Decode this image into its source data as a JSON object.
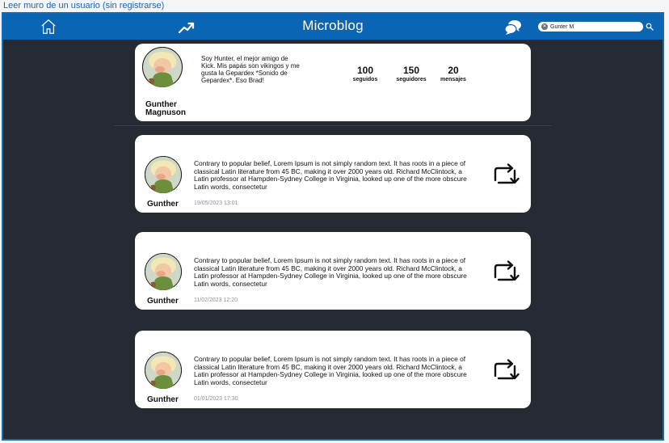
{
  "caption": "Leer muro de un usuario (sin registrarse)",
  "topbar": {
    "title": "Microblog",
    "home_icon": "home-icon",
    "trending_icon": "trending-icon",
    "chat_icon": "chat-icon",
    "search_value": "Gunter M",
    "search_icon": "search-icon",
    "clear_icon": "clear-icon",
    "color": "#0a66b5"
  },
  "profile": {
    "name": "Gunther Magnuson",
    "bio": "Soy Hunter, el mejor amigo de Kick. Mis papás son vikingos y me gusta la Gepardex *Sonido de Gepardex*. Eso Brad!",
    "stats": [
      {
        "value": "100",
        "label": "seguidos"
      },
      {
        "value": "150",
        "label": "seguidores"
      },
      {
        "value": "20",
        "label": "mensajes"
      }
    ]
  },
  "posts": [
    {
      "author": "Gunther",
      "text": "Contrary to popular belief, Lorem Ipsum is not simply random text. It has roots in a piece of classical Latin literature from 45 BC, making it over 2000 years old. Richard McClintock, a Latin professor at Hampden-Sydney College in Virginia, looked up one of the more obscure Latin words, consectetur",
      "date": "19/05/2023 13:01"
    },
    {
      "author": "Gunther",
      "text": "Contrary to popular belief, Lorem Ipsum is not simply random text. It has roots in a piece of classical Latin literature from 45 BC, making it over 2000 years old. Richard McClintock, a Latin professor at Hampden-Sydney College in Virginia, looked up one of the more obscure Latin words, consectetur",
      "date": "11/02/2023 12:20"
    },
    {
      "author": "Gunther",
      "text": "Contrary to popular belief, Lorem Ipsum is not simply random text. It has roots in a piece of classical Latin literature from 45 BC, making it over 2000 years old. Richard McClintock, a Latin professor at Hampden-Sydney College in Virginia, looked up one of the more obscure Latin words, consectetur",
      "date": "01/01/2023 17:30"
    }
  ],
  "colors": {
    "background": "#252a33",
    "card": "#ffffff",
    "accent": "#0a66b5",
    "date_text": "#8b8f96"
  }
}
